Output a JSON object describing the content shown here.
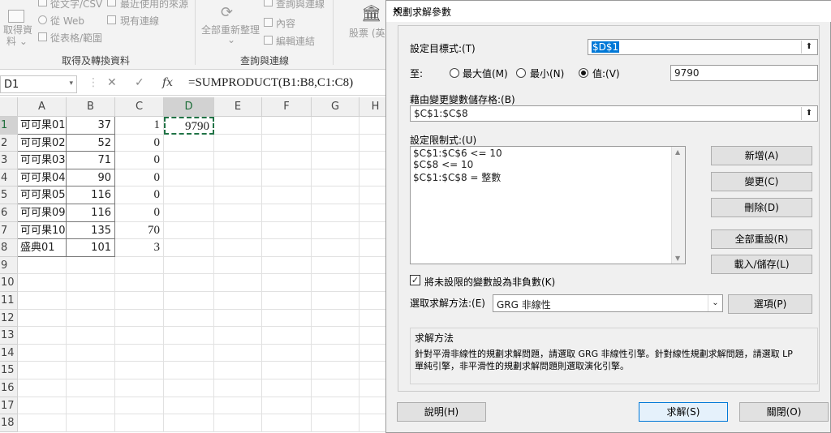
{
  "ribbon": {
    "from_text_csv": "從文字/CSV",
    "recent_sources": "最近使用的來源",
    "get_data": "取得資",
    "get_data2": "料 ⌄",
    "from_web": "從 Web",
    "existing_connections": "現有連線",
    "from_table": "從表格/範圍",
    "refresh_all": "全部重新整理",
    "refresh_arrow": "⌄",
    "queries_connections": "查詢與連線",
    "properties": "內容",
    "edit_links": "編輯連結",
    "stocks": "股票 (英",
    "group_get_transform": "取得及轉換資料",
    "group_queries": "查詢與連線"
  },
  "formula_bar": {
    "name_box": "D1",
    "cancel": "✕",
    "enter": "✓",
    "fx": "fx",
    "formula": "=SUMPRODUCT(B1:B8,C1:C8)"
  },
  "grid": {
    "columns": [
      "A",
      "B",
      "C",
      "D",
      "E",
      "F",
      "G",
      "H"
    ],
    "rows": [
      {
        "n": "1",
        "a": "可可果01",
        "b": "37",
        "c": "1",
        "d": "9790"
      },
      {
        "n": "2",
        "a": "可可果02",
        "b": "52",
        "c": "0",
        "d": ""
      },
      {
        "n": "3",
        "a": "可可果03",
        "b": "71",
        "c": "0",
        "d": ""
      },
      {
        "n": "4",
        "a": "可可果04",
        "b": "90",
        "c": "0",
        "d": ""
      },
      {
        "n": "5",
        "a": "可可果05",
        "b": "116",
        "c": "0",
        "d": ""
      },
      {
        "n": "6",
        "a": "可可果09",
        "b": "116",
        "c": "0",
        "d": ""
      },
      {
        "n": "7",
        "a": "可可果10",
        "b": "135",
        "c": "70",
        "d": ""
      },
      {
        "n": "8",
        "a": "盛典01",
        "b": "101",
        "c": "3",
        "d": ""
      },
      {
        "n": "9"
      },
      {
        "n": "10"
      },
      {
        "n": "11"
      },
      {
        "n": "12"
      },
      {
        "n": "13"
      },
      {
        "n": "14"
      },
      {
        "n": "15"
      },
      {
        "n": "16"
      },
      {
        "n": "17"
      },
      {
        "n": "18"
      }
    ]
  },
  "dialog": {
    "title": "規劃求解參數",
    "close": "✕",
    "objective_label": "設定目標式:(T)",
    "objective_value": "$D$1",
    "to_label": "至:",
    "opt_max": "最大值(M)",
    "opt_min": "最小(N)",
    "opt_value": "值:(V)",
    "selected_option": "value",
    "value_of": "9790",
    "changing_label": "藉由變更變數儲存格:(B)",
    "changing_value": "$C$1:$C$8",
    "ref_icon": "⬆",
    "constraints_label": "設定限制式:(U)",
    "constraints": [
      "$C$1:$C$6 <= 10",
      "$C$8 <= 10",
      "$C$1:$C$8 = 整數"
    ],
    "btn_add": "新增(A)",
    "btn_change": "變更(C)",
    "btn_delete": "刪除(D)",
    "btn_reset": "全部重設(R)",
    "btn_load_save": "載入/儲存(L)",
    "nonneg_label": "將未設限的變數設為非負數(K)",
    "nonneg_checked": true,
    "method_label": "選取求解方法:(E)",
    "method_value": "GRG 非線性",
    "btn_options": "選項(P)",
    "desc_title": "求解方法",
    "desc_line1": "針對平滑非線性的規劃求解問題，請選取 GRG 非線性引擎。針對線性規劃求解問題，請選取 LP",
    "desc_line2": "單純引擎，非平滑性的規劃求解問題則選取演化引擎。",
    "btn_help": "說明(H)",
    "btn_solve": "求解(S)",
    "btn_close": "關閉(O)"
  }
}
